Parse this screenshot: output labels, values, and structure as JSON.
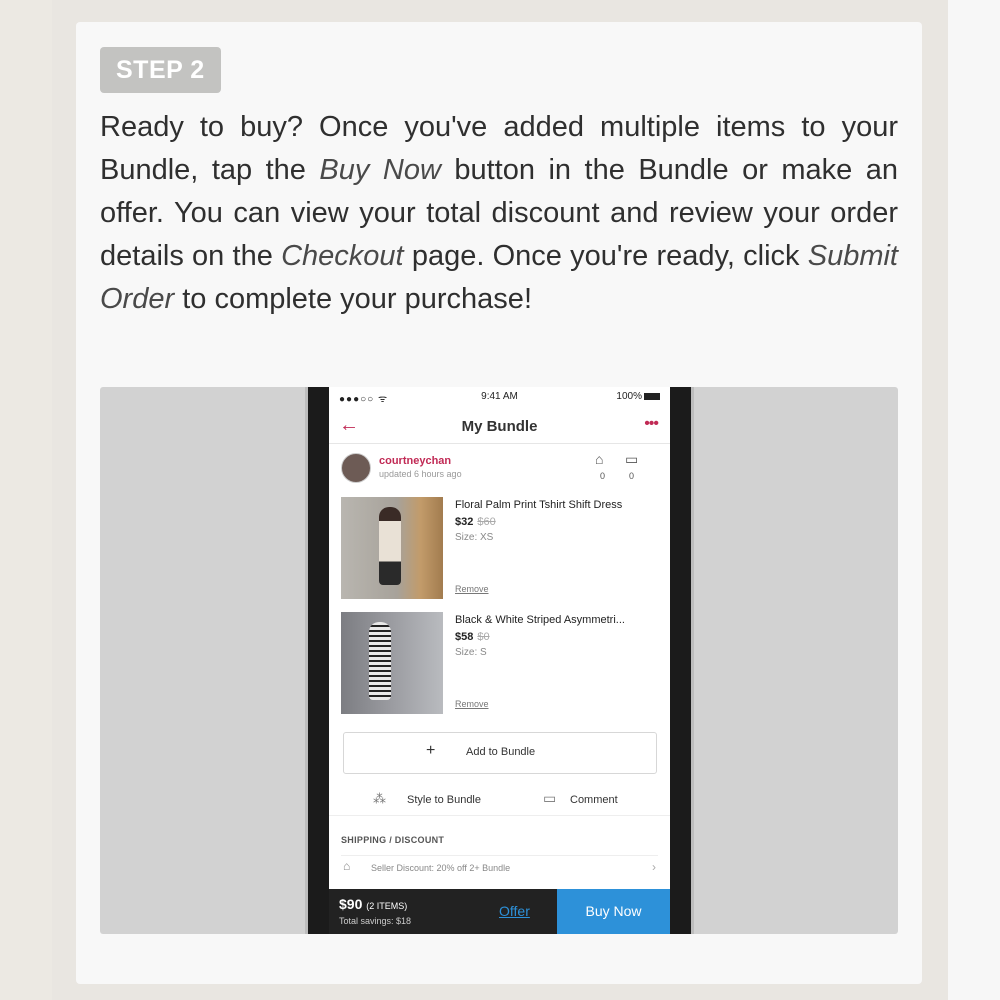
{
  "step": {
    "badge": "STEP 2"
  },
  "paragraph": {
    "t1": "Ready to buy? Once you've added multiple items to your Bundle, tap the ",
    "em1": "Buy Now",
    "t2": " button in the Bundle or make an offer. You can view your total discount and review your order details on the ",
    "em2": "Checkout",
    "t3": " page. Once you're ready, click ",
    "em3": "Submit Order",
    "t4": " to complete your purchase!"
  },
  "phone": {
    "status": {
      "signal": "●●●○○ ᯤ",
      "time": "9:41 AM",
      "battery": "100%"
    },
    "nav": {
      "title": "My Bundle",
      "back_icon": "back-arrow-icon",
      "more_icon": "more-dots-icon"
    },
    "seller": {
      "name": "courtneychan",
      "updated": "updated 6 hours ago",
      "like_count": "0",
      "comment_count": "0"
    },
    "items": [
      {
        "name": "Floral Palm Print Tshirt Shift Dress",
        "price": "$32",
        "original": "$60",
        "size": "Size: XS",
        "remove": "Remove"
      },
      {
        "name": "Black & White Striped Asymmetri...",
        "price": "$58",
        "original": "$0",
        "size": "Size: S",
        "remove": "Remove"
      }
    ],
    "add_button": {
      "icon": "+",
      "label": "Add to Bundle"
    },
    "actions": {
      "style_label": "Style to Bundle",
      "comment_label": "Comment"
    },
    "shipping": {
      "heading": "SHIPPING / DISCOUNT",
      "discount_text": "Seller Discount: 20% off 2+ Bundle"
    },
    "footer": {
      "total": "$90",
      "items_count": "(2 ITEMS)",
      "savings": "Total savings: $18",
      "offer_label": "Offer",
      "buy_label": "Buy Now"
    }
  },
  "colors": {
    "accent": "#c12a55",
    "buy_blue": "#2d91d9",
    "badge_gray": "#c3c3c1"
  }
}
